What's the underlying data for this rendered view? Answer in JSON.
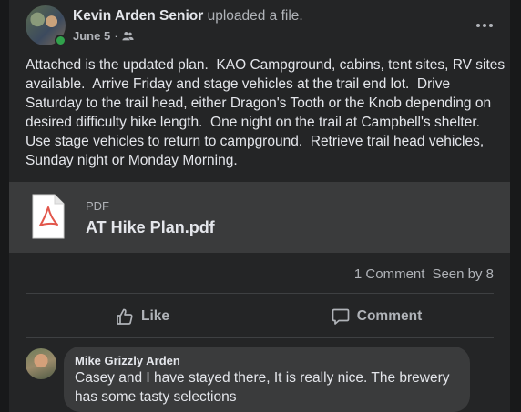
{
  "post": {
    "author": "Kevin Arden Senior",
    "action": "uploaded a file.",
    "date": "June 5",
    "separator": "·",
    "audience_icon": "friends-icon",
    "more_icon": "more-options-icon",
    "text": "Attached is the updated plan.  KAO Campground, cabins, tent sites, RV sites available.  Arrive Friday and stage vehicles at the trail end lot.  Drive Saturday to the trail head, either Dragon's Tooth or the Knob depending on desired difficulty hike length.  One night on the trail at Campbell's shelter.  Use stage vehicles to return to campground.  Retrieve trail head vehicles, Sunday night or Monday Morning."
  },
  "attachment": {
    "type": "PDF",
    "name": "AT Hike Plan.pdf",
    "icon": "pdf-file-icon"
  },
  "stats": {
    "comments": "1 Comment",
    "seen": "Seen by 8"
  },
  "actions": {
    "like": "Like",
    "comment": "Comment"
  },
  "comment": {
    "author": "Mike Grizzly Arden",
    "text": "Casey and I have stayed there, It is really nice. The brewery has some tasty selections"
  },
  "colors": {
    "background": "#18191a",
    "card": "#242526",
    "surface": "#3a3b3c",
    "primary_text": "#e4e6eb",
    "secondary_text": "#b0b3b8",
    "online": "#31a24c",
    "pdf_accent": "#e2574c"
  }
}
